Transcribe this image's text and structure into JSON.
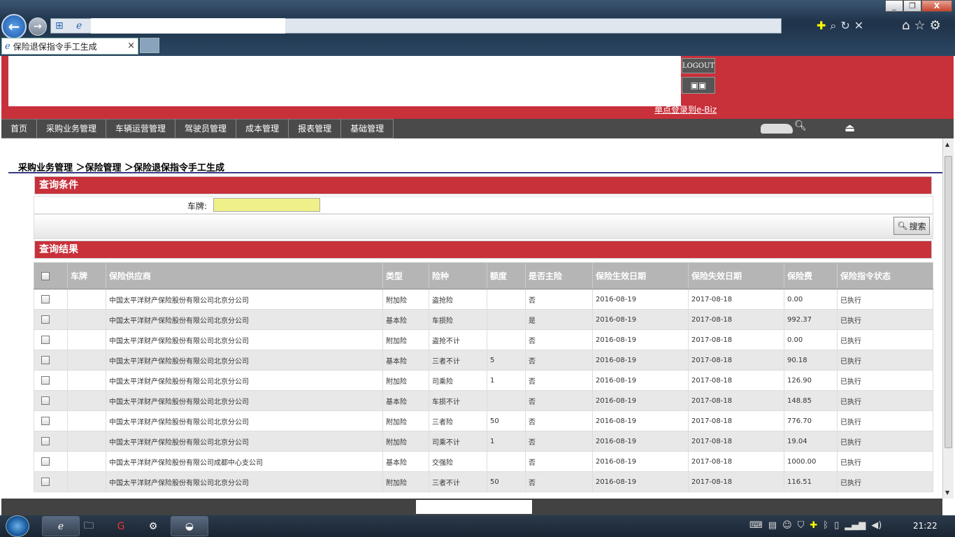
{
  "browser": {
    "tab_title": "保险退保指令手工生成",
    "tab_close": "×",
    "window": {
      "min": "_",
      "max": "❐",
      "close": "X"
    }
  },
  "header": {
    "logout_label": "LOGOUT",
    "ebiz_link": "单点登录到e-Biz"
  },
  "nav": {
    "items": [
      "首页",
      "采购业务管理",
      "车辆运营管理",
      "驾驶员管理",
      "成本管理",
      "报表管理",
      "基础管理"
    ]
  },
  "breadcrumb": "采购业务管理 ＞保险管理 ＞保险退保指令手工生成",
  "query": {
    "panel_title": "查询条件",
    "plate_label": "车牌:",
    "plate_value": "",
    "search_label": "搜索"
  },
  "results": {
    "panel_title": "查询结果",
    "columns": [
      "车牌",
      "保险供应商",
      "类型",
      "险种",
      "额度",
      "是否主险",
      "保险生效日期",
      "保险失效日期",
      "保险费",
      "保险指令状态"
    ],
    "rows": [
      [
        "",
        "中国太平洋财产保险股份有限公司北京分公司",
        "附加险",
        "盗抢险",
        "",
        "否",
        "2016-08-19",
        "2017-08-18",
        "0.00",
        "已执行"
      ],
      [
        "",
        "中国太平洋财产保险股份有限公司北京分公司",
        "基本险",
        "车损险",
        "",
        "是",
        "2016-08-19",
        "2017-08-18",
        "992.37",
        "已执行"
      ],
      [
        "",
        "中国太平洋财产保险股份有限公司北京分公司",
        "附加险",
        "盗抢不计",
        "",
        "否",
        "2016-08-19",
        "2017-08-18",
        "0.00",
        "已执行"
      ],
      [
        "",
        "中国太平洋财产保险股份有限公司北京分公司",
        "基本险",
        "三者不计",
        "5",
        "否",
        "2016-08-19",
        "2017-08-18",
        "90.18",
        "已执行"
      ],
      [
        "",
        "中国太平洋财产保险股份有限公司北京分公司",
        "附加险",
        "司乘险",
        "1",
        "否",
        "2016-08-19",
        "2017-08-18",
        "126.90",
        "已执行"
      ],
      [
        "",
        "中国太平洋财产保险股份有限公司北京分公司",
        "基本险",
        "车损不计",
        "",
        "否",
        "2016-08-19",
        "2017-08-18",
        "148.85",
        "已执行"
      ],
      [
        "",
        "中国太平洋财产保险股份有限公司北京分公司",
        "附加险",
        "三者险",
        "50",
        "否",
        "2016-08-19",
        "2017-08-18",
        "776.70",
        "已执行"
      ],
      [
        "",
        "中国太平洋财产保险股份有限公司北京分公司",
        "附加险",
        "司乘不计",
        "1",
        "否",
        "2016-08-19",
        "2017-08-18",
        "19.04",
        "已执行"
      ],
      [
        "",
        "中国太平洋财产保险股份有限公司成都中心支公司",
        "基本险",
        "交强险",
        "",
        "否",
        "2016-08-19",
        "2017-08-18",
        "1000.00",
        "已执行"
      ],
      [
        "",
        "中国太平洋财产保险股份有限公司北京分公司",
        "附加险",
        "三者不计",
        "50",
        "否",
        "2016-08-19",
        "2017-08-18",
        "116.51",
        "已执行"
      ]
    ]
  },
  "taskbar": {
    "clock": "21:22"
  },
  "colors": {
    "brand_red": "#c8303a",
    "nav_dark": "#4a4a4a",
    "table_header": "#b5b5b5"
  }
}
